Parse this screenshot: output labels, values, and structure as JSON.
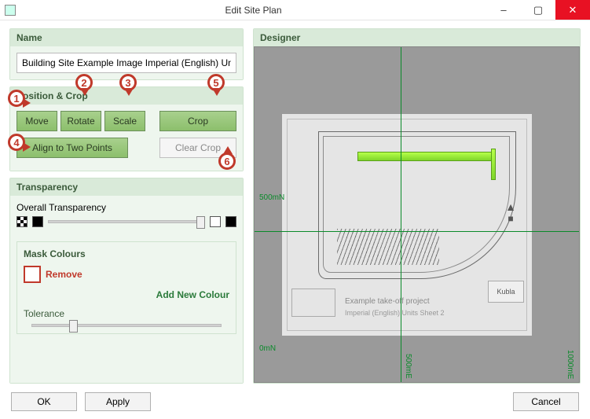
{
  "window": {
    "title": "Edit Site Plan",
    "icon": "app-icon",
    "minimize": "–",
    "maximize": "▢",
    "close": "✕"
  },
  "panels": {
    "name": {
      "header": "Name",
      "value": "Building Site Example Image Imperial (English) Units T"
    },
    "position_crop": {
      "header": "Position & Crop",
      "move": "Move",
      "rotate": "Rotate",
      "scale": "Scale",
      "crop": "Crop",
      "align": "Align to Two Points",
      "clear_crop": "Clear Crop"
    },
    "transparency": {
      "header": "Transparency",
      "overall_label": "Overall Transparency",
      "mask_header": "Mask Colours",
      "remove": "Remove",
      "add_colour": "Add New Colour",
      "tolerance": "Tolerance",
      "overall_value_pct": 98,
      "tolerance_value_pct": 22
    },
    "designer": {
      "header": "Designer",
      "axis_labels": {
        "y_top": "500mN",
        "y_bottom": "0mN",
        "x_mid": "500mE",
        "x_right": "1000mE"
      },
      "logo": "Kubla",
      "drawing_title": "Example take-off project",
      "drawing_subtitle": "Imperial (English) Units Sheet 2"
    }
  },
  "footer": {
    "ok": "OK",
    "apply": "Apply",
    "cancel": "Cancel"
  },
  "callouts": {
    "1": "1",
    "2": "2",
    "3": "3",
    "4": "4",
    "5": "5",
    "6": "6"
  }
}
